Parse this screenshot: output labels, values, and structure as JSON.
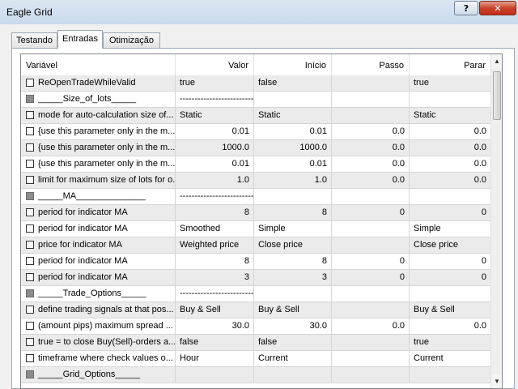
{
  "window": {
    "title": "Eagle Grid",
    "help_label": "?",
    "close_label": "✕"
  },
  "tabs": [
    {
      "label": "Testando"
    },
    {
      "label": "Entradas"
    },
    {
      "label": "Otimização"
    }
  ],
  "table": {
    "headers": [
      "Variável",
      "Valor",
      "Início",
      "Passo",
      "Parar"
    ],
    "rows": [
      {
        "name": "ReOpenTradeWhileValid",
        "valor": "true",
        "inicio": "false",
        "passo": "",
        "parar": "true",
        "sep": false
      },
      {
        "name": "_____Size_of_lots_____",
        "valor": "------------------------------------------------",
        "inicio": "",
        "passo": "",
        "parar": "",
        "sep": true
      },
      {
        "name": "mode for auto-calculation size of...",
        "valor": "Static",
        "inicio": "Static",
        "passo": "",
        "parar": "Static",
        "sep": false
      },
      {
        "name": "{use this parameter only in the m...",
        "valor": "0.01",
        "inicio": "0.01",
        "passo": "0.0",
        "parar": "0.0",
        "sep": false
      },
      {
        "name": "{use this parameter only in the m...",
        "valor": "1000.0",
        "inicio": "1000.0",
        "passo": "0.0",
        "parar": "0.0",
        "sep": false
      },
      {
        "name": "{use this parameter only in the m...",
        "valor": "0.01",
        "inicio": "0.01",
        "passo": "0.0",
        "parar": "0.0",
        "sep": false
      },
      {
        "name": "limit for maximum size of lots for o...",
        "valor": "1.0",
        "inicio": "1.0",
        "passo": "0.0",
        "parar": "0.0",
        "sep": false
      },
      {
        "name": "_____MA______________",
        "valor": "------------------------------------------------",
        "inicio": "",
        "passo": "",
        "parar": "",
        "sep": true
      },
      {
        "name": "period for indicator MA",
        "valor": "8",
        "inicio": "8",
        "passo": "0",
        "parar": "0",
        "sep": false
      },
      {
        "name": "period for indicator MA",
        "valor": "Smoothed",
        "inicio": "Simple",
        "passo": "",
        "parar": "Simple",
        "sep": false
      },
      {
        "name": "price for indicator MA",
        "valor": "Weighted price",
        "inicio": "Close price",
        "passo": "",
        "parar": "Close price",
        "sep": false
      },
      {
        "name": "period for indicator MA",
        "valor": "8",
        "inicio": "8",
        "passo": "0",
        "parar": "0",
        "sep": false
      },
      {
        "name": "period for indicator MA",
        "valor": "3",
        "inicio": "3",
        "passo": "0",
        "parar": "0",
        "sep": false
      },
      {
        "name": "_____Trade_Options_____",
        "valor": "------------------------------------------------",
        "inicio": "",
        "passo": "",
        "parar": "",
        "sep": true
      },
      {
        "name": "define trading signals at that pos...",
        "valor": "Buy & Sell",
        "inicio": "Buy & Sell",
        "passo": "",
        "parar": "Buy & Sell",
        "sep": false
      },
      {
        "name": "(amount pips) maximum spread ...",
        "valor": "30.0",
        "inicio": "30.0",
        "passo": "0.0",
        "parar": "0.0",
        "sep": false
      },
      {
        "name": "true = to close Buy(Sell)-orders a...",
        "valor": "false",
        "inicio": "false",
        "passo": "",
        "parar": "true",
        "sep": false
      },
      {
        "name": "timeframe where check values o...",
        "valor": "Hour",
        "inicio": "Current",
        "passo": "",
        "parar": "Current",
        "sep": false
      },
      {
        "name": "_____Grid_Options_____",
        "valor": "",
        "inicio": "",
        "passo": "",
        "parar": "",
        "sep": true
      }
    ]
  },
  "scrollbar": {
    "up_label": "▲",
    "down_label": "▼"
  }
}
